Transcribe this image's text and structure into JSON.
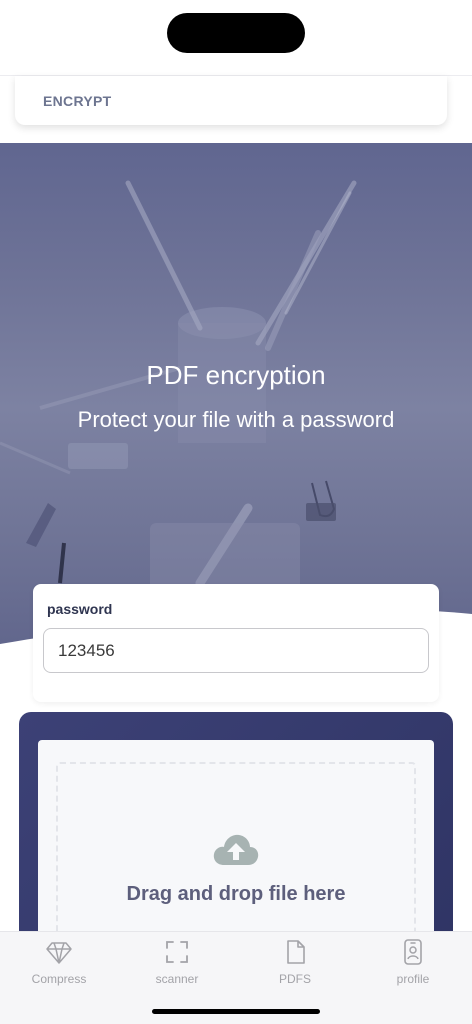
{
  "header": {
    "tab_label": "ENCRYPT"
  },
  "hero": {
    "title": "PDF encryption",
    "subtitle": "Protect your file with a password"
  },
  "password": {
    "label": "password",
    "value": "123456"
  },
  "upload": {
    "drop_text": "Drag and drop file here",
    "icon": "cloud-upload-icon"
  },
  "tab_bar": {
    "items": [
      {
        "label": "Compress",
        "icon": "diamond-icon"
      },
      {
        "label": "scanner",
        "icon": "scan-frame-icon"
      },
      {
        "label": "PDFS",
        "icon": "document-icon"
      },
      {
        "label": "profile",
        "icon": "id-badge-icon"
      }
    ]
  },
  "colors": {
    "hero_overlay": "#6e7397",
    "upload_panel": "#353a6c",
    "accent_text": "#5d5f7c"
  }
}
